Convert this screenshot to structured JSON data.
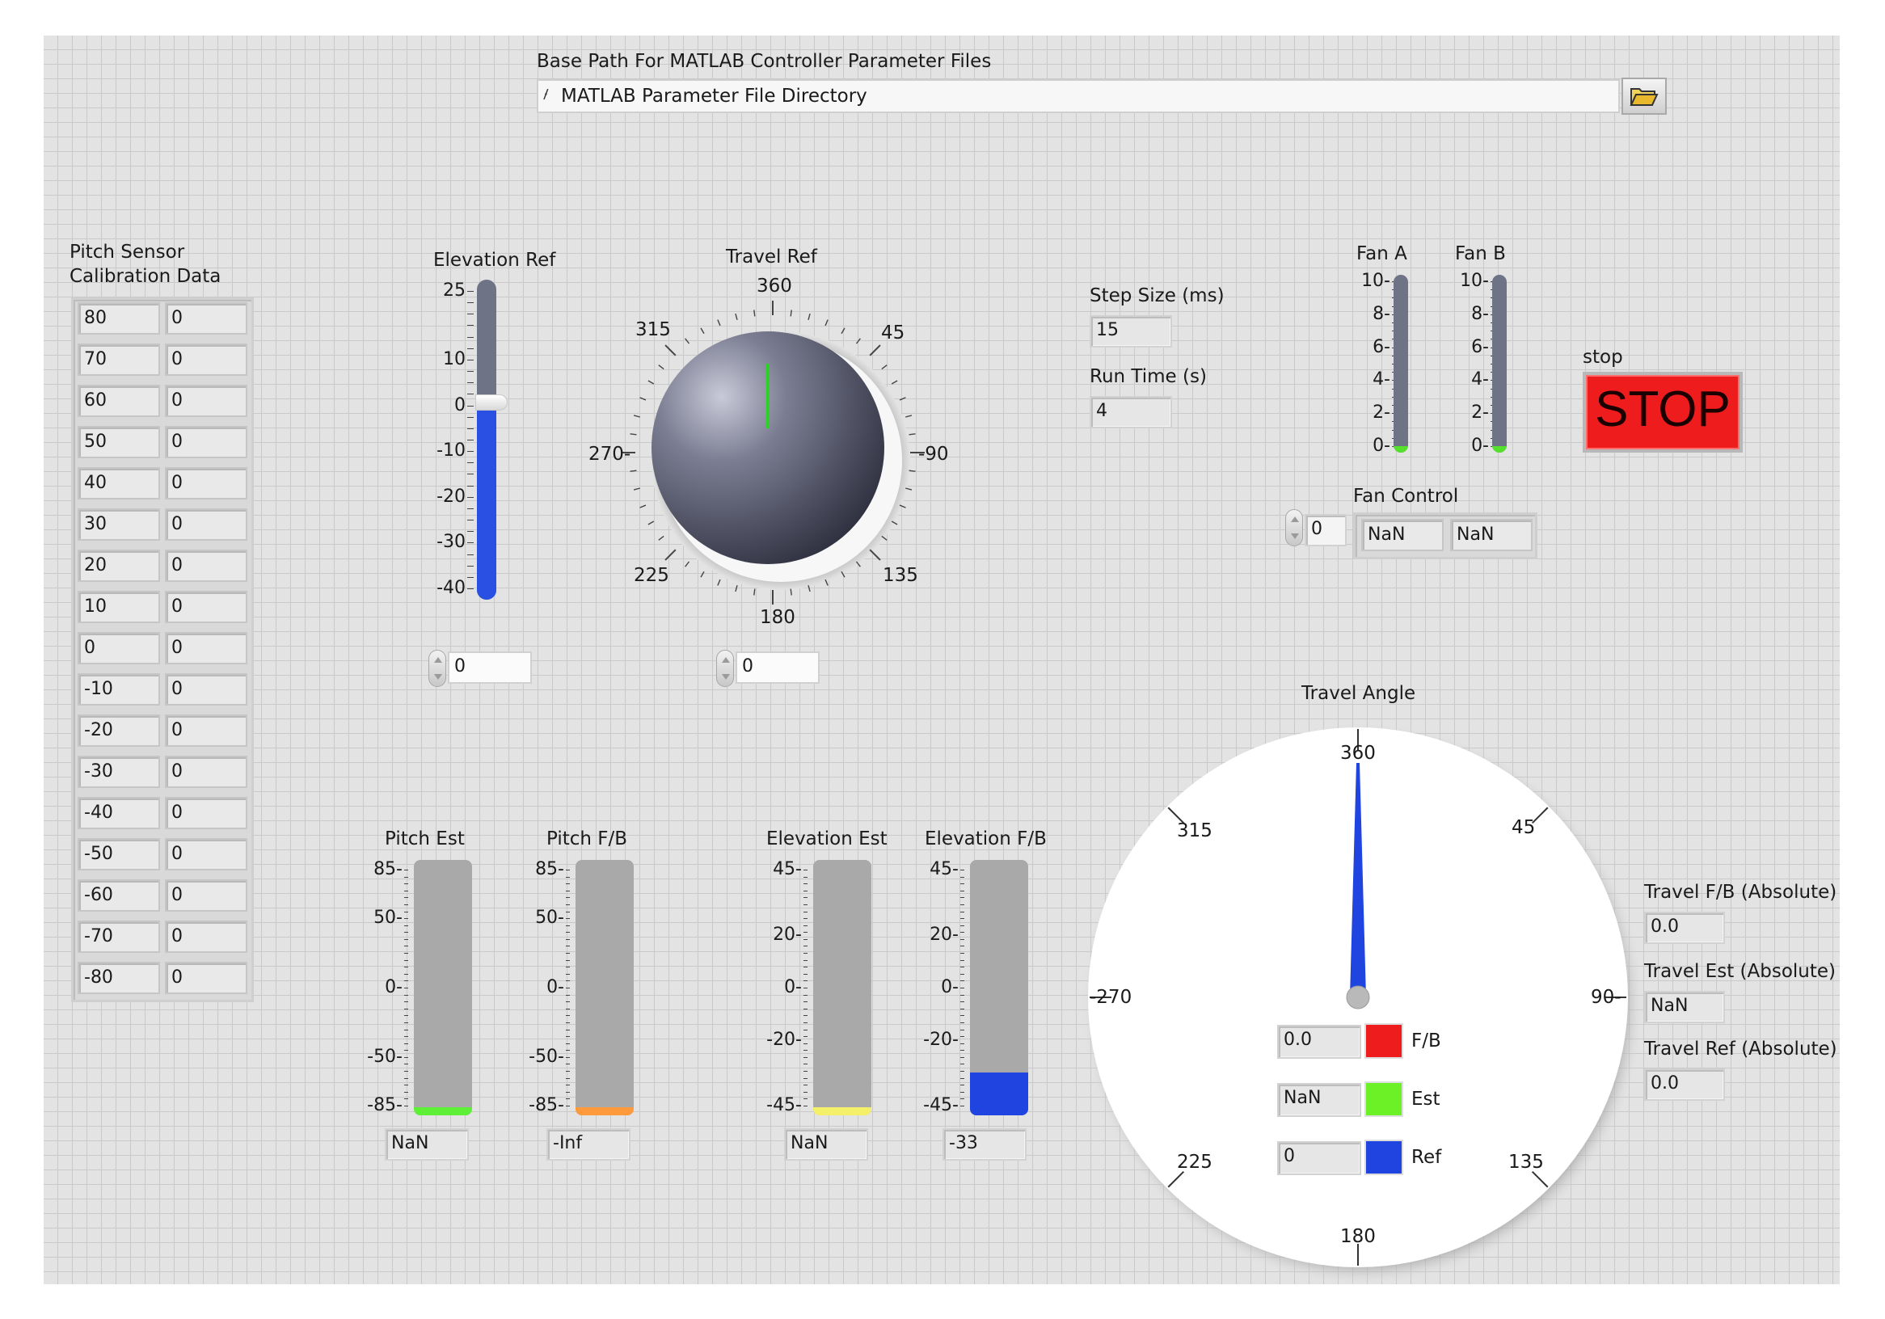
{
  "base_path": {
    "label": "Base Path For MATLAB Controller Parameter Files",
    "value": "MATLAB Parameter File Directory"
  },
  "pitch_calibration": {
    "label_line1": "Pitch Sensor",
    "label_line2": "Calibration Data",
    "rows": [
      [
        "80",
        "0"
      ],
      [
        "70",
        "0"
      ],
      [
        "60",
        "0"
      ],
      [
        "50",
        "0"
      ],
      [
        "40",
        "0"
      ],
      [
        "30",
        "0"
      ],
      [
        "20",
        "0"
      ],
      [
        "10",
        "0"
      ],
      [
        "0",
        "0"
      ],
      [
        "-10",
        "0"
      ],
      [
        "-20",
        "0"
      ],
      [
        "-30",
        "0"
      ],
      [
        "-40",
        "0"
      ],
      [
        "-50",
        "0"
      ],
      [
        "-60",
        "0"
      ],
      [
        "-70",
        "0"
      ],
      [
        "-80",
        "0"
      ]
    ]
  },
  "elevation_ref": {
    "label": "Elevation Ref",
    "scale": [
      "25",
      "10",
      "0",
      "-10",
      "-20",
      "-30",
      "-40"
    ],
    "value": "0",
    "level": 0,
    "range": [
      -40,
      25
    ]
  },
  "travel_ref": {
    "label": "Travel Ref",
    "scale": {
      "top": "360",
      "top_right": "45",
      "right": "-90",
      "bottom_right": "135",
      "bottom": "180",
      "bottom_left": "225",
      "left": "270-",
      "top_left": "315"
    },
    "value": "0"
  },
  "step_size": {
    "label": "Step Size (ms)",
    "value": "15"
  },
  "run_time": {
    "label": "Run Time (s)",
    "value": "4"
  },
  "fan_a": {
    "label": "Fan A",
    "scale": [
      "10-",
      "8-",
      "6-",
      "4-",
      "2-",
      "0-"
    ],
    "level": 0
  },
  "fan_b": {
    "label": "Fan B",
    "scale": [
      "10-",
      "8-",
      "6-",
      "4-",
      "2-",
      "0-"
    ],
    "level": 0
  },
  "stop": {
    "label": "stop",
    "button": "STOP"
  },
  "fan_control": {
    "label": "Fan Control",
    "index": "0",
    "values": [
      "NaN",
      "NaN"
    ]
  },
  "pitch_est": {
    "label": "Pitch Est",
    "scale": [
      "85-",
      "50-",
      "0-",
      "-50-",
      "-85-"
    ],
    "value": "NaN",
    "color": "#5ef037"
  },
  "pitch_fb": {
    "label": "Pitch F/B",
    "scale": [
      "85-",
      "50-",
      "0-",
      "-50-",
      "-85-"
    ],
    "value": "-Inf",
    "color": "#ff9a3c"
  },
  "elevation_est": {
    "label": "Elevation Est",
    "scale": [
      "45-",
      "20-",
      "0-",
      "-20-",
      "-45-"
    ],
    "value": "NaN",
    "color": "#f4f06a"
  },
  "elevation_fb": {
    "label": "Elevation F/B",
    "scale": [
      "45-",
      "20-",
      "0-",
      "-20-",
      "-45-"
    ],
    "value": "-33",
    "level": -33,
    "color": "#1f44e0"
  },
  "travel_angle": {
    "label": "Travel Angle",
    "scale": {
      "top": "360",
      "top_right": "45",
      "right": "90-",
      "bottom_right": "135",
      "bottom": "180",
      "bottom_left": "225",
      "left": "-270",
      "top_left": "315"
    },
    "legend": [
      {
        "value": "0.0",
        "name": "F/B",
        "color": "#ee1c1c"
      },
      {
        "value": "NaN",
        "name": "Est",
        "color": "#6cf026"
      },
      {
        "value": "0",
        "name": "Ref",
        "color": "#1f44e0"
      }
    ]
  },
  "travel_fb_abs": {
    "label": "Travel F/B (Absolute)",
    "value": "0.0"
  },
  "travel_est_abs": {
    "label": "Travel Est (Absolute)",
    "value": "NaN"
  },
  "travel_ref_abs": {
    "label": "Travel Ref (Absolute)",
    "value": "0.0"
  }
}
